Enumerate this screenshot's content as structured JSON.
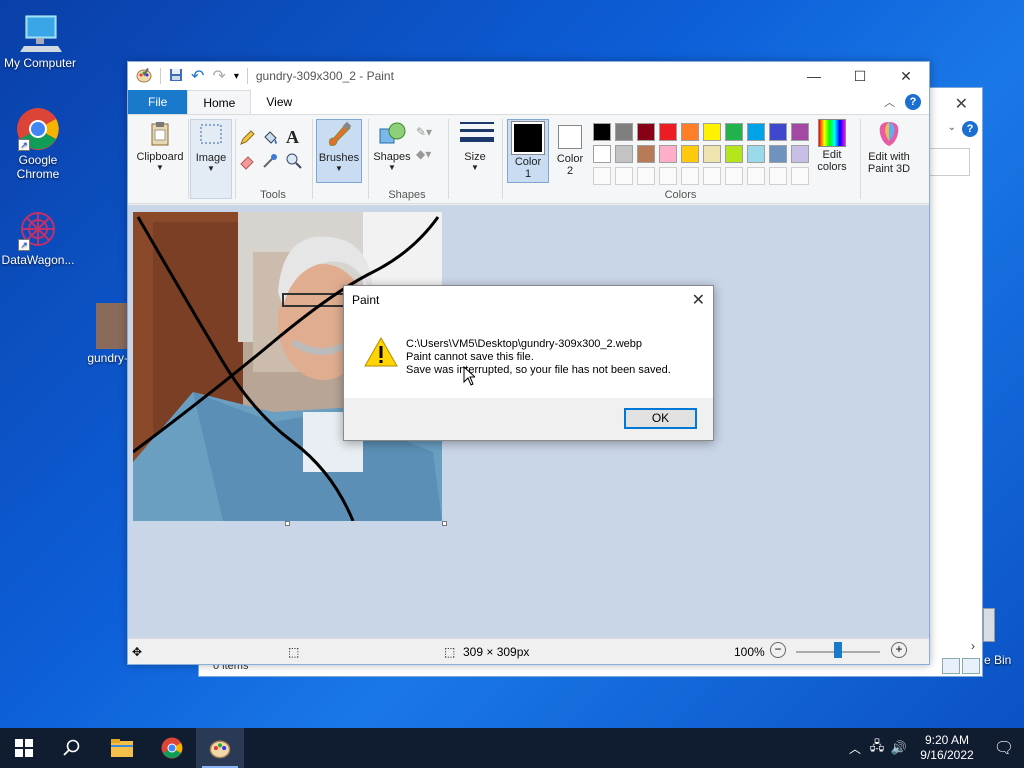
{
  "desktop": {
    "icons": [
      {
        "label": "My Computer"
      },
      {
        "label": "Google Chrome"
      },
      {
        "label": "DataWagon..."
      },
      {
        "label": "gundry-3..."
      }
    ],
    "recycle_partial": "e Bin"
  },
  "explorer_bg": {
    "items_label": "0 items"
  },
  "paint": {
    "title": "gundry-309x300_2 - Paint",
    "tabs": {
      "file": "File",
      "home": "Home",
      "view": "View"
    },
    "ribbon": {
      "clipboard": "Clipboard",
      "image": "Image",
      "tools": "Tools",
      "brushes": "Brushes",
      "shapes_btn": "Shapes",
      "shapes_group": "Shapes",
      "size": "Size",
      "color1_a": "Color",
      "color1_b": "1",
      "color2_a": "Color",
      "color2_b": "2",
      "colors_group": "Colors",
      "edit_colors_a": "Edit",
      "edit_colors_b": "colors",
      "paint3d_a": "Edit with",
      "paint3d_b": "Paint 3D"
    },
    "palette_row1": [
      "#000000",
      "#7f7f7f",
      "#880015",
      "#ed1c24",
      "#ff7f27",
      "#fff200",
      "#22b14c",
      "#00a2e8",
      "#3f48cc",
      "#a349a4"
    ],
    "palette_row2": [
      "#ffffff",
      "#c3c3c3",
      "#b97a57",
      "#ffaec9",
      "#ffc90e",
      "#efe4b0",
      "#b5e61d",
      "#99d9ea",
      "#7092be",
      "#c8bfe7"
    ],
    "status": {
      "dimensions": "309 × 309px",
      "zoom": "100%"
    }
  },
  "dialog": {
    "title": "Paint",
    "line1": "C:\\Users\\VM5\\Desktop\\gundry-309x300_2.webp",
    "line2": "Paint cannot save this file.",
    "line3": "Save was interrupted, so your file has not been saved.",
    "ok": "OK"
  },
  "taskbar": {
    "time": "9:20 AM",
    "date": "9/16/2022"
  }
}
